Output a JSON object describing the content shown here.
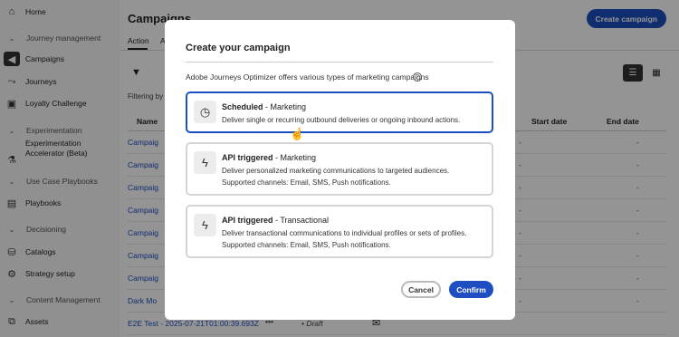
{
  "sidebar": {
    "items": [
      {
        "label": "Home",
        "icon": "home-icon",
        "glyph": "⌂",
        "type": "item"
      },
      {
        "label": "Journey management",
        "icon": "chevron-down-icon",
        "glyph": "⌄",
        "type": "section"
      },
      {
        "label": "Campaigns",
        "icon": "megaphone-icon",
        "glyph": "📣",
        "type": "selected"
      },
      {
        "label": "Journeys",
        "icon": "journey-icon",
        "glyph": "⤳",
        "type": "item"
      },
      {
        "label": "Loyalty Challenge",
        "icon": "challenge-icon",
        "glyph": "▣",
        "type": "item"
      },
      {
        "label": "Experimentation",
        "icon": "chevron-down-icon",
        "glyph": "⌄",
        "type": "section"
      },
      {
        "label": "Experimentation Accelerator (Beta)",
        "icon": "flask-icon",
        "glyph": "⚗",
        "type": "item"
      },
      {
        "label": "Use Case Playbooks",
        "icon": "chevron-down-icon",
        "glyph": "⌄",
        "type": "section"
      },
      {
        "label": "Playbooks",
        "icon": "playbook-icon",
        "glyph": "▤",
        "type": "item"
      },
      {
        "label": "Decisioning",
        "icon": "chevron-down-icon",
        "glyph": "⌄",
        "type": "section"
      },
      {
        "label": "Catalogs",
        "icon": "catalog-icon",
        "glyph": "⛁",
        "type": "item"
      },
      {
        "label": "Strategy setup",
        "icon": "strategy-icon",
        "glyph": "⚙",
        "type": "item"
      },
      {
        "label": "Content Management",
        "icon": "chevron-down-icon",
        "glyph": "⌄",
        "type": "section"
      },
      {
        "label": "Assets",
        "icon": "assets-icon",
        "glyph": "⧉",
        "type": "item"
      }
    ]
  },
  "header": {
    "title": "Campaigns",
    "create_button": "Create campaign",
    "tabs": [
      "Action",
      "A"
    ]
  },
  "toolbar": {
    "filtering_label": "Filtering by"
  },
  "table": {
    "columns": {
      "name": "Name",
      "start_date": "Start date",
      "end_date": "End date"
    },
    "rows": [
      {
        "name": "Campaig",
        "start": "-",
        "end": "-"
      },
      {
        "name": "Campaig",
        "start": "-",
        "end": "-"
      },
      {
        "name": "Campaig",
        "start": "-",
        "end": "-"
      },
      {
        "name": "Campaig",
        "start": "-",
        "end": "-"
      },
      {
        "name": "Campaig",
        "start": "-",
        "end": "-"
      },
      {
        "name": "Campaig",
        "start": "-",
        "end": "-"
      },
      {
        "name": "Campaig",
        "start": "-",
        "end": "-"
      },
      {
        "name": "Dark Mo",
        "start": "-",
        "end": "-"
      }
    ],
    "last_row": {
      "name": "E2E Test - 2025-07-21T01:00:39.693Z",
      "more": "•••",
      "status": "• Draft"
    }
  },
  "dialog": {
    "title": "Create your campaign",
    "description": "Adobe Journeys Optimizer offers various types of marketing campaigns",
    "help_glyph": "?",
    "cards": [
      {
        "title_bold": "Scheduled",
        "title_rest": " - Marketing",
        "text": "Deliver single or recurring outbound deliveries or ongoing inbound actions.",
        "icon": "clock-icon",
        "glyph": "🕓",
        "selected": true
      },
      {
        "title_bold": "API triggered",
        "title_rest": " - Marketing",
        "text": "Deliver personalized marketing communications to targeted audiences. Supported channels: Email, SMS, Push notifications.",
        "icon": "lightning-icon",
        "glyph": "⚡",
        "selected": false
      },
      {
        "title_bold": "API triggered",
        "title_rest": " - Transactional",
        "text": "Deliver transactional communications to individual profiles or sets of profiles. Supported channels: Email, SMS, Push notifications.",
        "icon": "lightning-icon",
        "glyph": "⚡",
        "selected": false
      }
    ],
    "cancel_label": "Cancel",
    "confirm_label": "Confirm"
  },
  "colors": {
    "accent": "#1d4fc2",
    "overlay": "rgba(0,0,0,0.42)"
  }
}
